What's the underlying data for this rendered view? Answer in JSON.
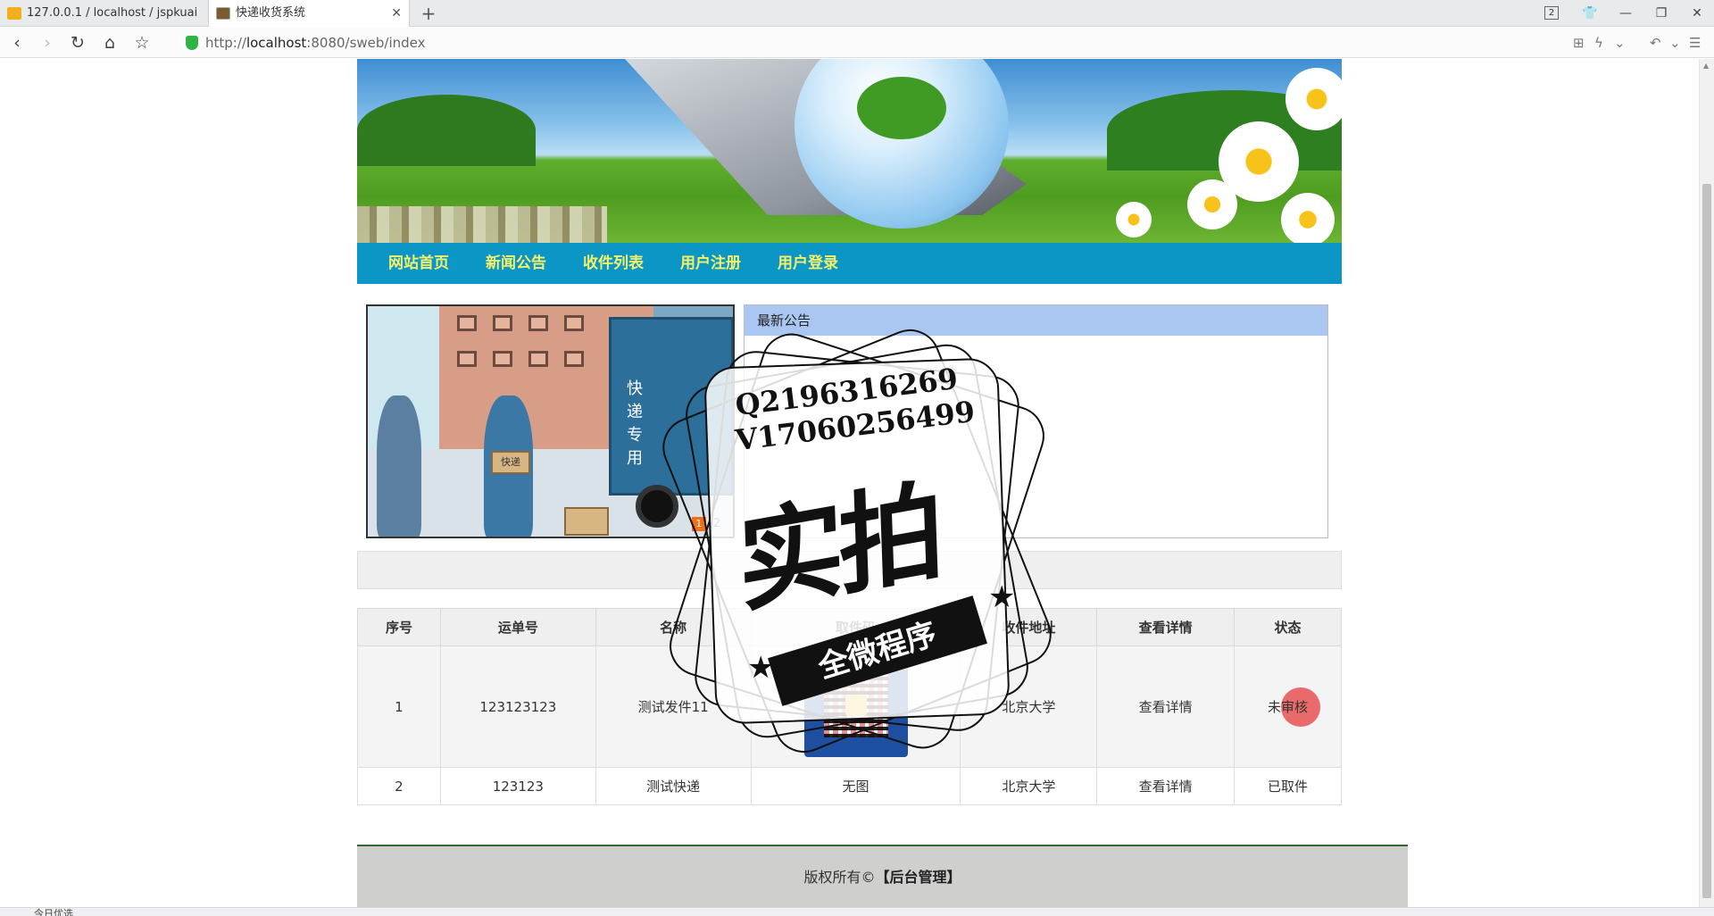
{
  "browser": {
    "tabs": [
      {
        "title": "127.0.0.1 / localhost / jspkuai"
      },
      {
        "title": "快递收货系统"
      }
    ],
    "tab_count": "2",
    "url_prefix": "http://",
    "url_host": "localhost",
    "url_rest": ":8080/sweb/index"
  },
  "nav": {
    "items": [
      "网站首页",
      "新闻公告",
      "收件列表",
      "用户注册",
      "用户登录"
    ]
  },
  "slider": {
    "truck_text": "快递专用",
    "box_text": "快递",
    "dots": [
      "1",
      "2"
    ]
  },
  "notice": {
    "title": "最新公告"
  },
  "table": {
    "headers": [
      "序号",
      "运单号",
      "名称",
      "取件码",
      "收件地址",
      "查看详情",
      "状态"
    ],
    "rows": [
      {
        "index": "1",
        "waybill": "123123123",
        "name": "测试发件11",
        "code": "qr-image",
        "address": "北京大学",
        "detail": "查看详情",
        "status": "未审核"
      },
      {
        "index": "2",
        "waybill": "123123",
        "name": "测试快递",
        "code": "无图",
        "address": "北京大学",
        "detail": "查看详情",
        "status": "已取件"
      }
    ]
  },
  "footer": {
    "copyright": "版权所有©",
    "admin_link": "【后台管理】"
  },
  "watermark": {
    "line1": "Q2196316269",
    "line2": "V17060256499",
    "big": "实拍",
    "ribbon": "全微程序"
  },
  "status_strip": {
    "left": "今日优选"
  }
}
